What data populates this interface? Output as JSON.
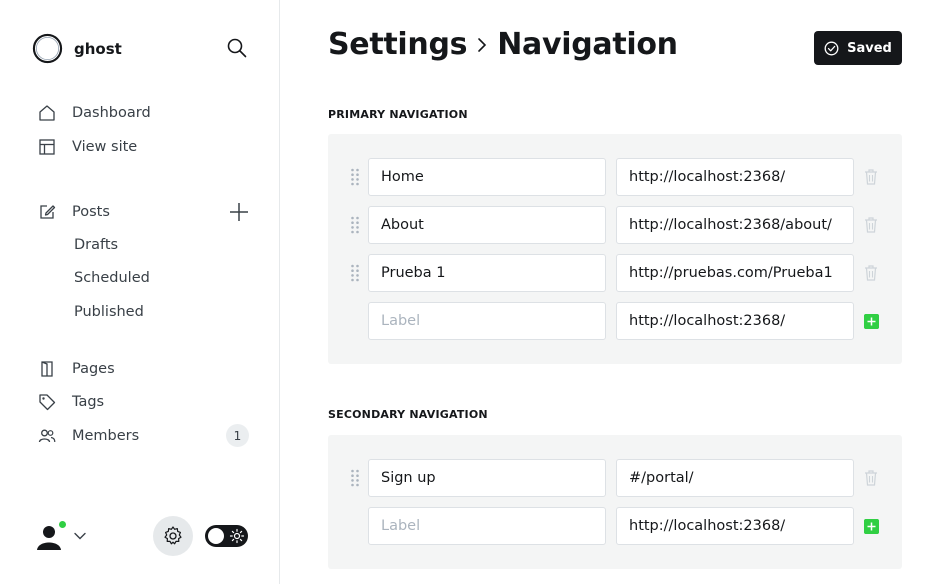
{
  "brand": {
    "name": "ghost"
  },
  "sidebar": {
    "items": [
      {
        "label": "Dashboard",
        "icon": "home-icon"
      },
      {
        "label": "View site",
        "icon": "layout-icon"
      },
      {
        "label": "Posts",
        "icon": "edit-icon"
      },
      {
        "label": "Pages",
        "icon": "page-icon"
      },
      {
        "label": "Tags",
        "icon": "tag-icon"
      },
      {
        "label": "Members",
        "icon": "members-icon",
        "count": "1"
      }
    ],
    "post_subitems": [
      "Drafts",
      "Scheduled",
      "Published"
    ]
  },
  "header": {
    "section": "Settings",
    "page": "Navigation",
    "save_label": "Saved"
  },
  "primary": {
    "heading": "PRIMARY NAVIGATION",
    "items": [
      {
        "label": "Home",
        "url": "http://localhost:2368/"
      },
      {
        "label": "About",
        "url": "http://localhost:2368/about/"
      },
      {
        "label": "Prueba 1",
        "url": "http://pruebas.com/Prueba1"
      }
    ],
    "new_item": {
      "label_placeholder": "Label",
      "url": "http://localhost:2368/"
    }
  },
  "secondary": {
    "heading": "SECONDARY NAVIGATION",
    "items": [
      {
        "label": "Sign up",
        "url": "#/portal/"
      }
    ],
    "new_item": {
      "label_placeholder": "Label",
      "url": "http://localhost:2368/"
    }
  },
  "colors": {
    "accent_green": "#30cf43",
    "dark": "#15171a",
    "panel_bg": "#f4f5f5"
  }
}
